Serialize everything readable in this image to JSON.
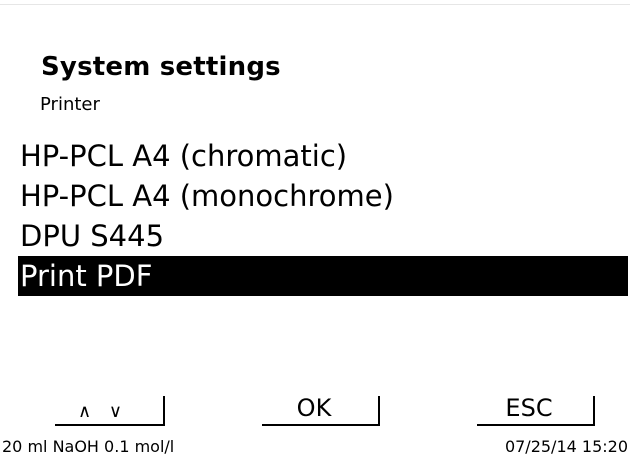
{
  "header": {
    "title": "System settings",
    "subtitle": "Printer"
  },
  "menu": {
    "items": [
      {
        "label": "HP-PCL A4 (chromatic)",
        "selected": false
      },
      {
        "label": "HP-PCL A4 (monochrome)",
        "selected": false
      },
      {
        "label": "DPU S445",
        "selected": false
      },
      {
        "label": "Print PDF",
        "selected": true
      }
    ]
  },
  "softkeys": {
    "nav_label": "∧ ∨",
    "ok_label": "OK",
    "esc_label": "ESC"
  },
  "status": {
    "reagent": "20 ml NaOH 0.1 mol/l",
    "datetime": "07/25/14 15:20"
  },
  "colors": {
    "background": "#ffffff",
    "text": "#000000",
    "selection_background": "#000000",
    "selection_text": "#ffffff"
  }
}
